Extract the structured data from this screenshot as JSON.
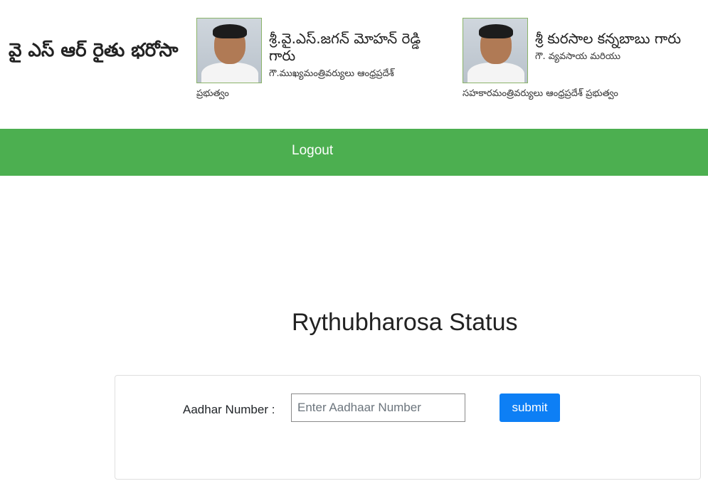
{
  "header": {
    "site_title": "వై ఎస్ ఆర్ రైతు భరోసా",
    "officials": [
      {
        "name": "శ్రీ.వై.ఎస్.జగన్ మోహన్ రెడ్డి గారు",
        "role_line1": "గౌ.ముఖ్యమంత్రివర్యులు ఆంధ్రప్రదేశ్",
        "role_line2": "ప్రభుత్వం"
      },
      {
        "name": "శ్రీ కురసాల కన్నబాబు గారు",
        "role_line1": "గౌ. వ్యవసాయ మరియు",
        "role_line2": "సహకారమంత్రివర్యులు ఆంధ్రప్రదేశ్ ప్రభుత్వం"
      }
    ]
  },
  "nav": {
    "logout_label": "Logout",
    "bar_color": "#4caf50"
  },
  "main": {
    "title": "Rythubharosa Status",
    "form": {
      "aadhar_label": "Aadhar Number :",
      "aadhar_placeholder": "Enter Aadhaar Number",
      "aadhar_value": "",
      "submit_label": "submit",
      "submit_color": "#0d7ff5"
    }
  }
}
